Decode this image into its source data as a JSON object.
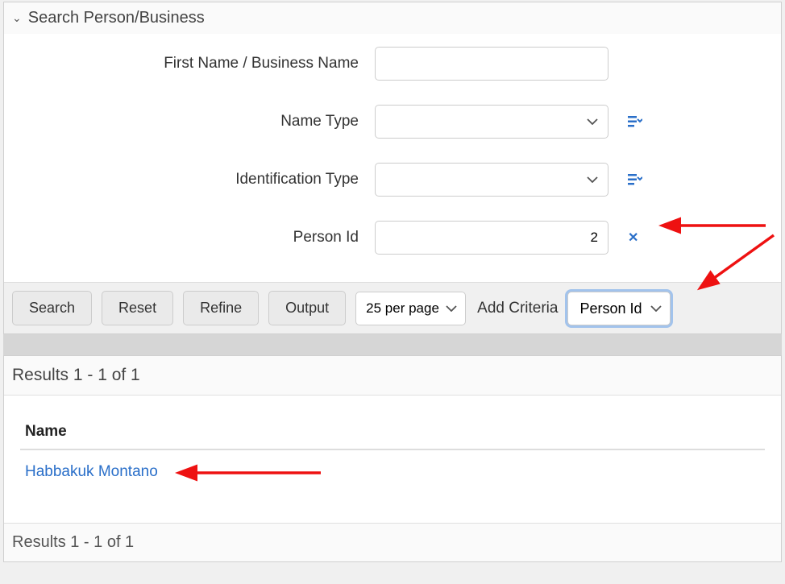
{
  "panel": {
    "title": "Search Person/Business"
  },
  "form": {
    "first_name_label": "First Name / Business Name",
    "first_name_value": "",
    "name_type_label": "Name Type",
    "name_type_value": "",
    "id_type_label": "Identification Type",
    "id_type_value": "",
    "person_id_label": "Person Id",
    "person_id_value": "2"
  },
  "toolbar": {
    "search_label": "Search",
    "reset_label": "Reset",
    "refine_label": "Refine",
    "output_label": "Output",
    "per_page_value": "25 per page",
    "add_criteria_label": "Add Criteria",
    "criteria_value": "Person Id"
  },
  "results": {
    "header_text": "Results 1 - 1 of 1",
    "footer_text": "Results 1 - 1 of 1",
    "columns": {
      "name": "Name"
    },
    "rows": [
      {
        "name": "Habbakuk Montano"
      }
    ]
  }
}
